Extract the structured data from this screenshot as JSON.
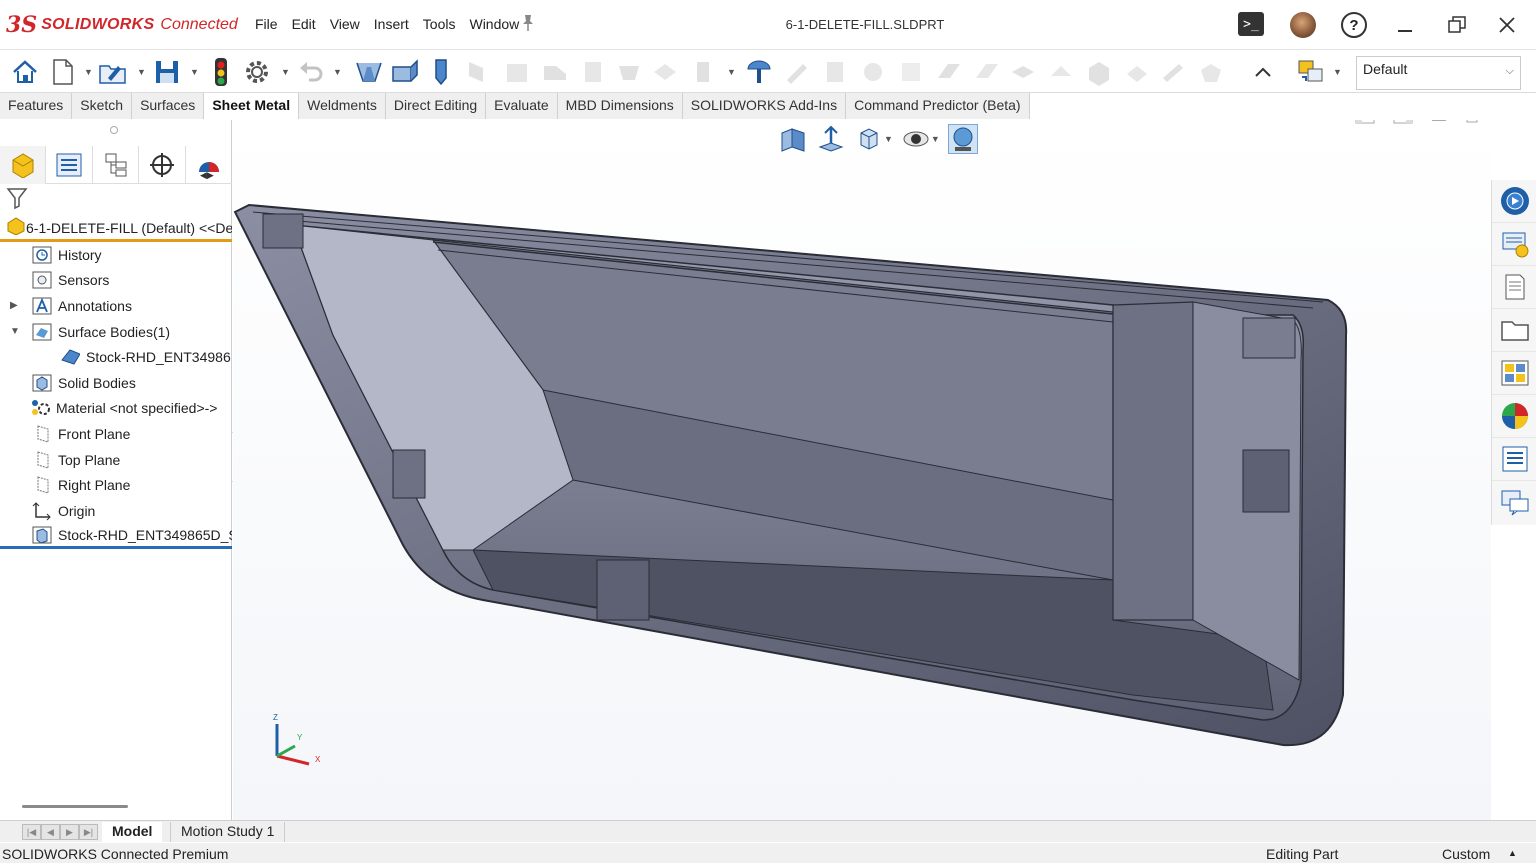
{
  "app": {
    "logo_ds": "3S",
    "logo_brand": "SOLIDWORKS",
    "logo_suffix": "Connected",
    "document_title": "6-1-DELETE-FILL.SLDPRT",
    "menu": [
      "File",
      "Edit",
      "View",
      "Insert",
      "Tools",
      "Window"
    ]
  },
  "toolbar": {
    "configuration": "Default"
  },
  "command_tabs": [
    "Features",
    "Sketch",
    "Surfaces",
    "Sheet Metal",
    "Weldments",
    "Direct Editing",
    "Evaluate",
    "MBD Dimensions",
    "SOLIDWORKS Add-Ins",
    "Command Predictor (Beta)"
  ],
  "active_tab": "Sheet Metal",
  "feature_tree": {
    "root": "6-1-DELETE-FILL (Default) <<De",
    "items": [
      {
        "label": "History",
        "icon": "history-icon",
        "expand": ""
      },
      {
        "label": "Sensors",
        "icon": "sensors-icon",
        "expand": ""
      },
      {
        "label": "Annotations",
        "icon": "annotations-icon",
        "expand": "▶"
      },
      {
        "label": "Surface Bodies(1)",
        "icon": "surface-bodies-icon",
        "expand": "▼"
      },
      {
        "label": "Stock-RHD_ENT34986",
        "icon": "surface-body-icon",
        "expand": "",
        "indent": true
      },
      {
        "label": "Solid Bodies",
        "icon": "solid-bodies-icon",
        "expand": ""
      },
      {
        "label": "Material <not specified>->",
        "icon": "material-icon",
        "expand": ""
      },
      {
        "label": "Front Plane",
        "icon": "plane-icon",
        "expand": ""
      },
      {
        "label": "Top Plane",
        "icon": "plane-icon",
        "expand": ""
      },
      {
        "label": "Right Plane",
        "icon": "plane-icon",
        "expand": ""
      },
      {
        "label": "Origin",
        "icon": "origin-icon",
        "expand": ""
      },
      {
        "label": "Stock-RHD_ENT349865D_S",
        "icon": "part-feature-icon",
        "expand": ""
      }
    ]
  },
  "bottom_tabs": [
    "Model",
    "Motion Study 1"
  ],
  "status": {
    "product": "SOLIDWORKS Connected Premium",
    "mode": "Editing Part",
    "units": "Custom"
  },
  "colors": {
    "brand_red": "#d1272b",
    "tree_root_underline": "#e39b1a",
    "tree_end_underline": "#2a6bb8",
    "model_gray": "#5a5d6e"
  }
}
